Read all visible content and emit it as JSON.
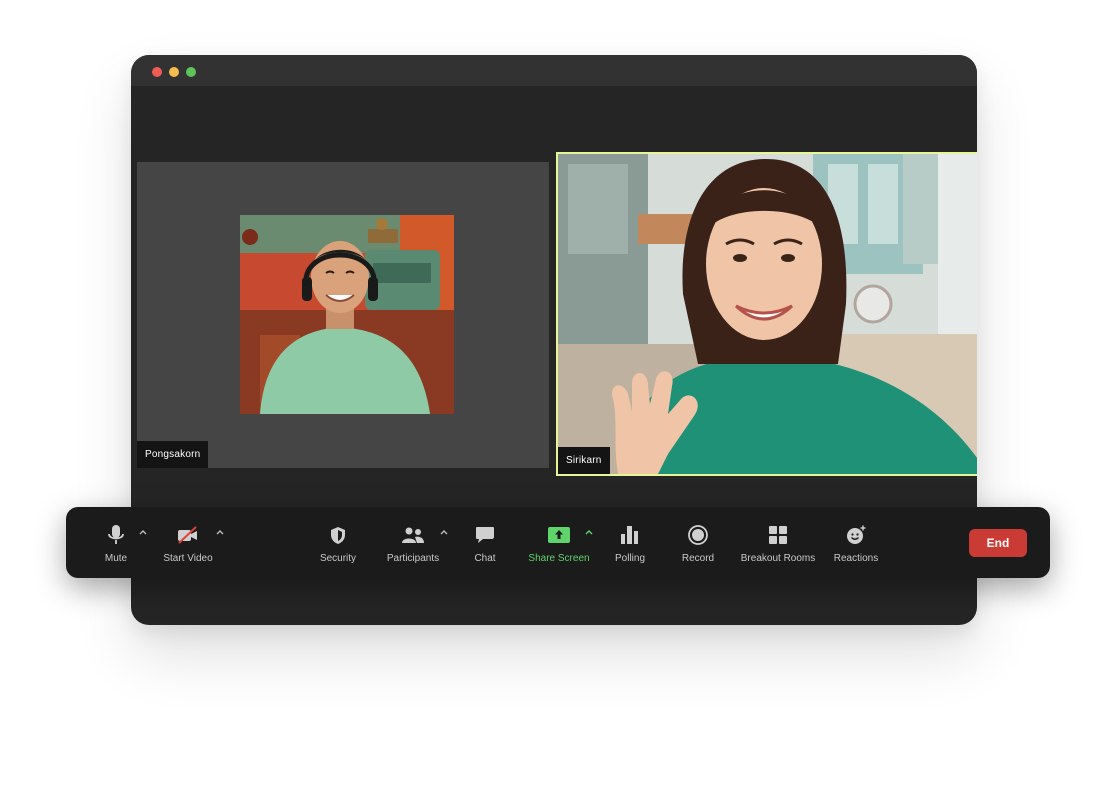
{
  "window": {
    "controls": [
      "close",
      "minimize",
      "maximize"
    ]
  },
  "participants": [
    {
      "name": "Pongsakorn"
    },
    {
      "name": "Sirikarn",
      "active_speaker": true
    }
  ],
  "toolbar": {
    "mute_label": "Mute",
    "start_video_label": "Start Video",
    "security_label": "Security",
    "participants_label": "Participants",
    "chat_label": "Chat",
    "share_screen_label": "Share Screen",
    "polling_label": "Polling",
    "record_label": "Record",
    "breakout_rooms_label": "Breakout Rooms",
    "reactions_label": "Reactions",
    "end_label": "End"
  },
  "icons": [
    "microphone-icon",
    "video-off-icon",
    "shield-icon",
    "people-icon",
    "chat-bubble-icon",
    "share-screen-icon",
    "bar-chart-icon",
    "record-icon",
    "grid-icon",
    "smiley-icon",
    "chevron-up-icon"
  ],
  "colors": {
    "accent_green": "#5fd46a",
    "end_red": "#cb3b35",
    "active_speaker_border": "#e7f599"
  }
}
